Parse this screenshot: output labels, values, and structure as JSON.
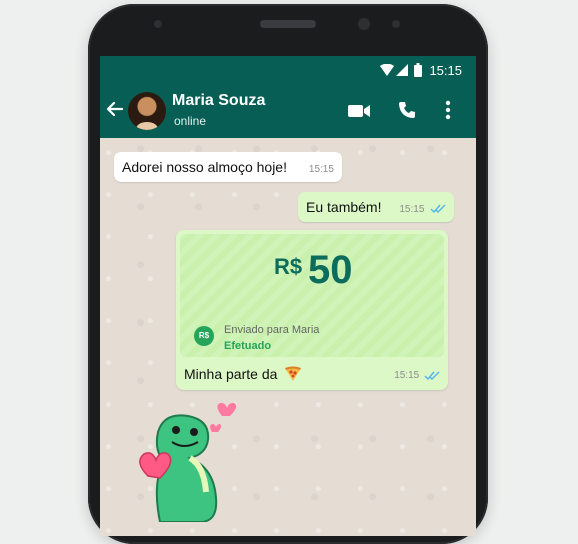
{
  "status_bar": {
    "time": "15:15"
  },
  "header": {
    "contact_name": "Maria Souza",
    "status": "online"
  },
  "icons": {
    "back": "arrow-left-icon",
    "video": "video-call-icon",
    "call": "phone-icon",
    "menu": "more-vert-icon"
  },
  "colors": {
    "header": "#075e54",
    "bubble_out": "#dcf8c6",
    "bubble_in": "#ffffff",
    "accent": "#25a45a",
    "read_checks": "#4fb6ec"
  },
  "messages": [
    {
      "direction": "in",
      "text": "Adorei nosso almoço hoje!",
      "time": "15:15"
    },
    {
      "direction": "out",
      "text": "Eu também!",
      "time": "15:15",
      "read": true
    }
  ],
  "payment": {
    "currency": "R$",
    "amount": "50",
    "badge": "R$",
    "sent_to": "Enviado para Maria",
    "status": "Efetuado",
    "caption": "Minha parte da",
    "caption_emoji": "pizza-slice",
    "time": "15:15",
    "read": true
  },
  "sticker": "green-dinosaur-with-hearts"
}
